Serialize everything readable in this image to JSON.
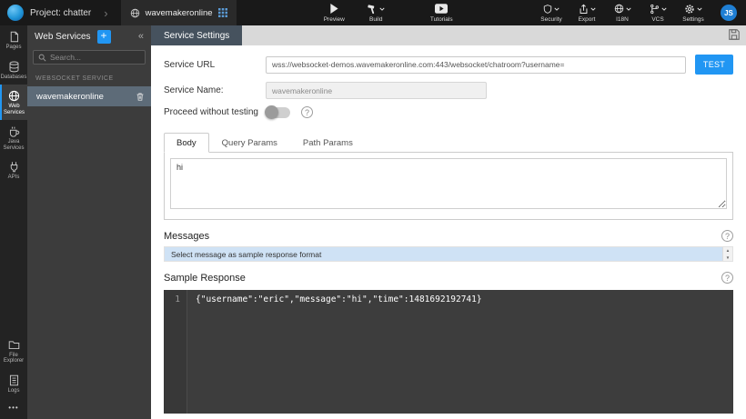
{
  "topbar": {
    "project_label": "Project: chatter",
    "service_tab": "wavemakeronline",
    "preview_label": "Preview",
    "build_label": "Build",
    "tutorials_label": "Tutorials",
    "security_label": "Security",
    "export_label": "Export",
    "i18n_label": "I18N",
    "vcs_label": "VCS",
    "settings_label": "Settings",
    "avatar": "JS"
  },
  "sidebar": {
    "items": [
      {
        "label": "Pages"
      },
      {
        "label": "Databases"
      },
      {
        "label": "Web Services"
      },
      {
        "label": "Java Services"
      },
      {
        "label": "APIs"
      },
      {
        "label": "File Explorer"
      },
      {
        "label": "Logs"
      }
    ],
    "more": "•••"
  },
  "panel": {
    "title": "Web Services",
    "add_button": "+",
    "collapse": "«",
    "search_placeholder": "Search...",
    "section_label": "WEBSOCKET SERVICE",
    "service_name": "wavemakeronline"
  },
  "main": {
    "tab_label": "Service Settings",
    "form": {
      "service_url_label": "Service URL",
      "service_url_value": "wss://websocket-demos.wavemakeronline.com:443/websocket/chatroom?username=",
      "test_button": "TEST",
      "service_name_label": "Service Name:",
      "service_name_value": "wavemakeronline",
      "proceed_label": "Proceed without testing"
    },
    "param_tabs": [
      {
        "label": "Body"
      },
      {
        "label": "Query Params"
      },
      {
        "label": "Path Params"
      }
    ],
    "body_text": "hi",
    "messages_title": "Messages",
    "messages_selected": "Select message as sample response format",
    "scroll_up": "▲",
    "scroll_down": "▼",
    "sample_response_title": "Sample Response",
    "code_line_number": "1",
    "code": "{\"username\":\"eric\",\"message\":\"hi\",\"time\":1481692192741}"
  },
  "colors": {
    "accent_blue": "#2196f3",
    "selected_row": "#cfe2f5",
    "active_tab": "#46525e",
    "code_bg": "#3d3d3d"
  }
}
